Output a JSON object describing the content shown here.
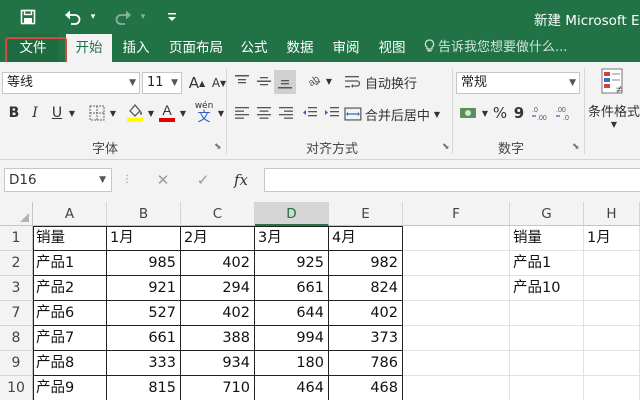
{
  "app": {
    "title": "新建 Microsoft Ex",
    "accent_color": "#217346",
    "highlight_color": "#d14a3a"
  },
  "quick_access": [
    {
      "name": "save-icon",
      "glyph": "🖫"
    },
    {
      "name": "undo-icon",
      "glyph": "↶"
    },
    {
      "name": "redo-icon",
      "glyph": "↷"
    },
    {
      "name": "customize-icon",
      "glyph": "▾"
    }
  ],
  "tabs": {
    "file": "文件",
    "home": "开始",
    "insert": "插入",
    "layout": "页面布局",
    "formulas": "公式",
    "data": "数据",
    "review": "审阅",
    "view": "视图",
    "tell_me": "告诉我您想要做什么..."
  },
  "ribbon": {
    "font_name": "等线",
    "font_size": "11",
    "bold": "B",
    "italic": "I",
    "underline": "U",
    "wen": "wén",
    "wen_char": "文",
    "wrap_text": "自动换行",
    "merge_center": "合并后居中",
    "number_format": "常规",
    "percent": "%",
    "comma": "9",
    "conditional_format": "条件格式",
    "group_font": "字体",
    "group_alignment": "对齐方式",
    "group_number": "数字"
  },
  "formula_bar": {
    "name_box": "D16",
    "cancel": "✕",
    "enter": "✓",
    "fx": "fx",
    "value": ""
  },
  "grid": {
    "columns": [
      "A",
      "B",
      "C",
      "D",
      "E",
      "F",
      "G",
      "H"
    ],
    "selected_column": "D",
    "row_numbers": [
      "1",
      "2",
      "3",
      "7",
      "8",
      "9",
      "10"
    ],
    "rows": [
      [
        "销量",
        "1月",
        "2月",
        "3月",
        "4月",
        "",
        "销量",
        "1月"
      ],
      [
        "产品1",
        "985",
        "402",
        "925",
        "982",
        "",
        "产品1",
        ""
      ],
      [
        "产品2",
        "921",
        "294",
        "661",
        "824",
        "",
        "产品10",
        ""
      ],
      [
        "产品6",
        "527",
        "402",
        "644",
        "402",
        "",
        "",
        ""
      ],
      [
        "产品7",
        "661",
        "388",
        "994",
        "373",
        "",
        "",
        ""
      ],
      [
        "产品8",
        "333",
        "934",
        "180",
        "786",
        "",
        "",
        ""
      ],
      [
        "产品9",
        "815",
        "710",
        "464",
        "468",
        "",
        "",
        ""
      ]
    ]
  }
}
